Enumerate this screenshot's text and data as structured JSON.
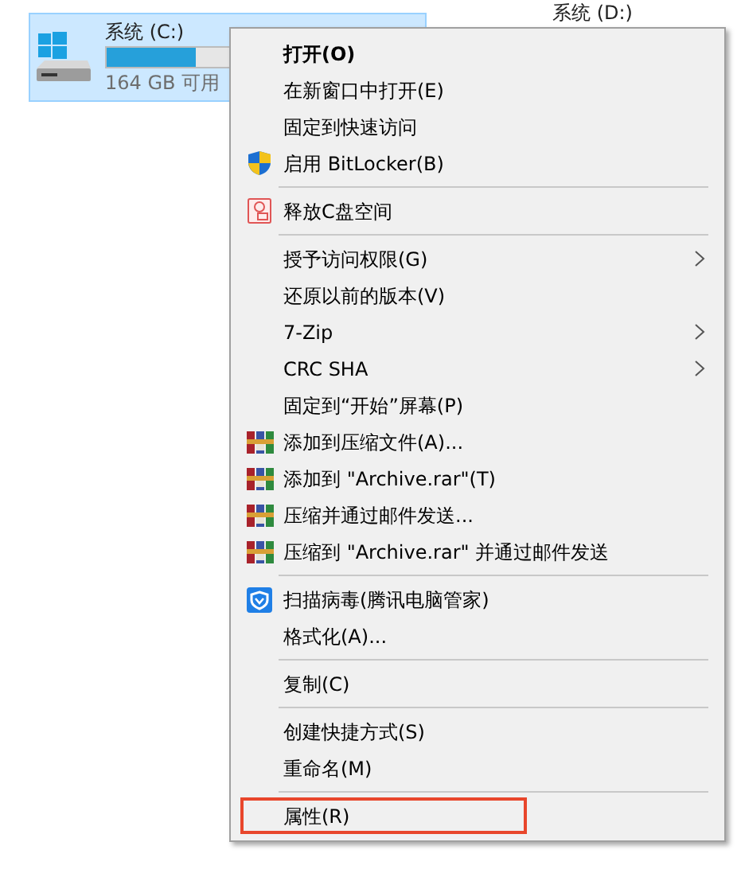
{
  "drives": [
    {
      "name": "系统 (C:)",
      "free": "164 GB 可用",
      "level": 0.3,
      "selected": true
    },
    {
      "name": "系统 (D:)",
      "selected": false
    }
  ],
  "menu": {
    "items": [
      {
        "kind": "item",
        "label": "打开(O)",
        "bold": true
      },
      {
        "kind": "item",
        "label": "在新窗口中打开(E)"
      },
      {
        "kind": "item",
        "label": "固定到快速访问"
      },
      {
        "kind": "shield",
        "label": "启用 BitLocker(B)"
      },
      {
        "kind": "separator"
      },
      {
        "kind": "cleanup",
        "label": "释放C盘空间"
      },
      {
        "kind": "separator"
      },
      {
        "kind": "item",
        "label": "授予访问权限(G)",
        "submenu": true
      },
      {
        "kind": "item",
        "label": "还原以前的版本(V)"
      },
      {
        "kind": "item",
        "label": "7-Zip",
        "submenu": true
      },
      {
        "kind": "item",
        "label": "CRC SHA",
        "submenu": true
      },
      {
        "kind": "item",
        "label": "固定到“开始”屏幕(P)"
      },
      {
        "kind": "archive",
        "label": "添加到压缩文件(A)..."
      },
      {
        "kind": "archive",
        "label": "添加到 \"Archive.rar\"(T)"
      },
      {
        "kind": "archive",
        "label": "压缩并通过邮件发送..."
      },
      {
        "kind": "archive",
        "label": "压缩到 \"Archive.rar\" 并通过邮件发送"
      },
      {
        "kind": "separator"
      },
      {
        "kind": "guard",
        "label": "扫描病毒(腾讯电脑管家)"
      },
      {
        "kind": "item",
        "label": "格式化(A)..."
      },
      {
        "kind": "separator"
      },
      {
        "kind": "item",
        "label": "复制(C)"
      },
      {
        "kind": "separator"
      },
      {
        "kind": "item",
        "label": "创建快捷方式(S)"
      },
      {
        "kind": "item",
        "label": "重命名(M)"
      },
      {
        "kind": "separator"
      },
      {
        "kind": "item",
        "label": "属性(R)",
        "boxed": true
      }
    ]
  }
}
